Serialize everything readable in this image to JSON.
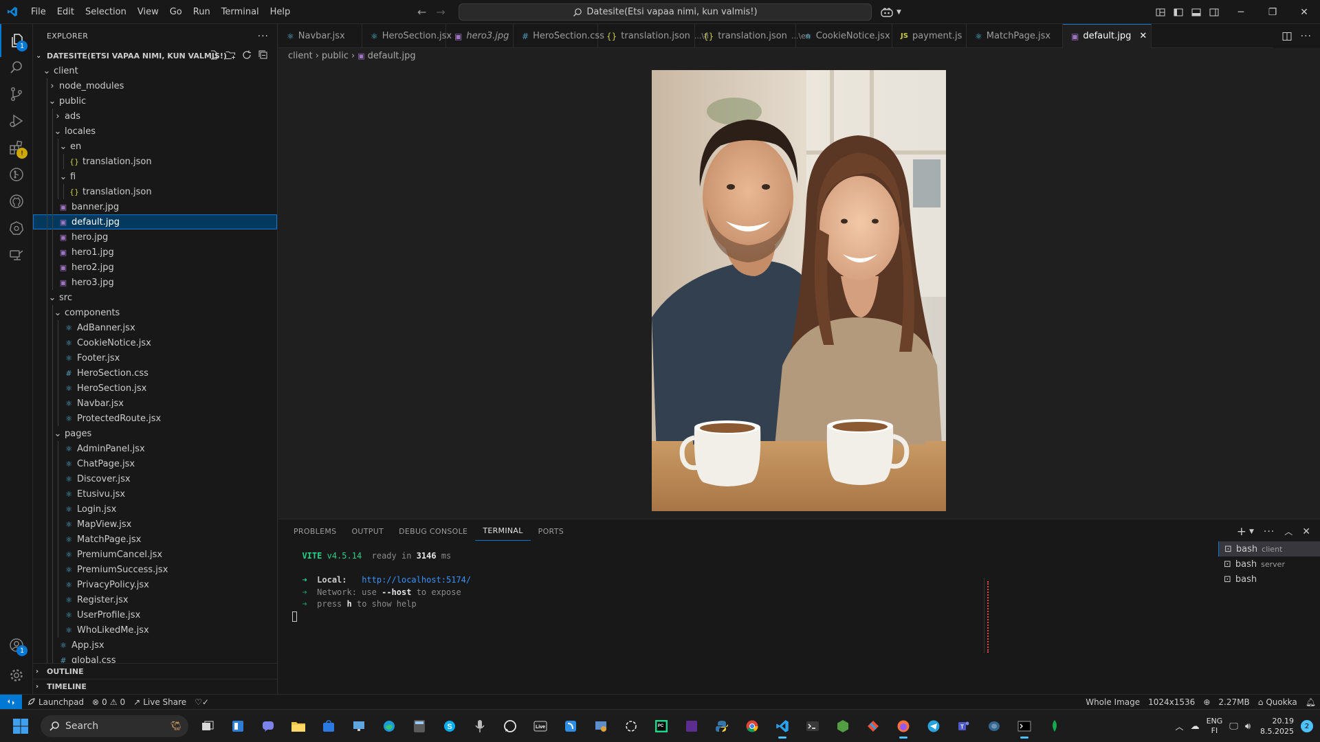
{
  "titlebar": {
    "menu": [
      "File",
      "Edit",
      "Selection",
      "View",
      "Go",
      "Run",
      "Terminal",
      "Help"
    ],
    "command_center": "Datesite(Etsi vapaa nimi, kun valmis!)"
  },
  "sidebar": {
    "title": "EXPLORER",
    "workspace": "DATESITE(ETSI VAPAA NIMI, KUN VALMIS!)",
    "tree": [
      {
        "label": "client",
        "kind": "folder-open"
      },
      {
        "label": "node_modules",
        "kind": "folder"
      },
      {
        "label": "public",
        "kind": "folder-open"
      },
      {
        "label": "ads",
        "kind": "folder"
      },
      {
        "label": "locales",
        "kind": "folder-open"
      },
      {
        "label": "en",
        "kind": "folder-open"
      },
      {
        "label": "translation.json",
        "kind": "json"
      },
      {
        "label": "fi",
        "kind": "folder-open"
      },
      {
        "label": "translation.json",
        "kind": "json"
      },
      {
        "label": "banner.jpg",
        "kind": "image"
      },
      {
        "label": "default.jpg",
        "kind": "image"
      },
      {
        "label": "hero.jpg",
        "kind": "image"
      },
      {
        "label": "hero1.jpg",
        "kind": "image"
      },
      {
        "label": "hero2.jpg",
        "kind": "image"
      },
      {
        "label": "hero3.jpg",
        "kind": "image"
      },
      {
        "label": "src",
        "kind": "folder-open"
      },
      {
        "label": "components",
        "kind": "folder-open"
      },
      {
        "label": "AdBanner.jsx",
        "kind": "react"
      },
      {
        "label": "CookieNotice.jsx",
        "kind": "react"
      },
      {
        "label": "Footer.jsx",
        "kind": "react"
      },
      {
        "label": "HeroSection.css",
        "kind": "css"
      },
      {
        "label": "HeroSection.jsx",
        "kind": "react"
      },
      {
        "label": "Navbar.jsx",
        "kind": "react"
      },
      {
        "label": "ProtectedRoute.jsx",
        "kind": "react"
      },
      {
        "label": "pages",
        "kind": "folder-open"
      },
      {
        "label": "AdminPanel.jsx",
        "kind": "react"
      },
      {
        "label": "ChatPage.jsx",
        "kind": "react"
      },
      {
        "label": "Discover.jsx",
        "kind": "react"
      },
      {
        "label": "Etusivu.jsx",
        "kind": "react"
      },
      {
        "label": "Login.jsx",
        "kind": "react"
      },
      {
        "label": "MapView.jsx",
        "kind": "react"
      },
      {
        "label": "MatchPage.jsx",
        "kind": "react"
      },
      {
        "label": "PremiumCancel.jsx",
        "kind": "react"
      },
      {
        "label": "PremiumSuccess.jsx",
        "kind": "react"
      },
      {
        "label": "PrivacyPolicy.jsx",
        "kind": "react"
      },
      {
        "label": "Register.jsx",
        "kind": "react"
      },
      {
        "label": "UserProfile.jsx",
        "kind": "react"
      },
      {
        "label": "WhoLikedMe.jsx",
        "kind": "react"
      },
      {
        "label": "App.jsx",
        "kind": "react"
      },
      {
        "label": "global.css",
        "kind": "css"
      }
    ],
    "outline": "OUTLINE",
    "timeline": "TIMELINE"
  },
  "tabs": [
    {
      "label": "Navbar.jsx",
      "kind": "react",
      "desc": ""
    },
    {
      "label": "HeroSection.jsx",
      "kind": "react",
      "desc": ""
    },
    {
      "label": "hero3.jpg",
      "kind": "image",
      "desc": ""
    },
    {
      "label": "HeroSection.css",
      "kind": "css",
      "desc": ""
    },
    {
      "label": "translation.json",
      "kind": "json",
      "desc": "...\\fi"
    },
    {
      "label": "translation.json",
      "kind": "json",
      "desc": "...\\en"
    },
    {
      "label": "CookieNotice.jsx",
      "kind": "react",
      "desc": ""
    },
    {
      "label": "payment.js",
      "kind": "js",
      "desc": ""
    },
    {
      "label": "MatchPage.jsx",
      "kind": "react",
      "desc": ""
    },
    {
      "label": "default.jpg",
      "kind": "image",
      "desc": ""
    }
  ],
  "breadcrumb": [
    "client",
    "public",
    "default.jpg"
  ],
  "panel": {
    "tabs": [
      "PROBLEMS",
      "OUTPUT",
      "DEBUG CONSOLE",
      "TERMINAL",
      "PORTS"
    ],
    "terminal": {
      "vite": "VITE",
      "version": "v4.5.14",
      "ready_prefix": "ready in",
      "ready_ms": "3146",
      "ready_unit": "ms",
      "arrow": "➜",
      "local_label": "Local:",
      "local_url": "http://localhost:5174/",
      "network_label": "Network:",
      "network_use": "use",
      "network_flag": "--host",
      "network_rest": "to expose",
      "press": "press",
      "press_key": "h",
      "press_rest": "to show help"
    },
    "terminals": [
      {
        "name": "bash",
        "desc": "client"
      },
      {
        "name": "bash",
        "desc": "server"
      },
      {
        "name": "bash",
        "desc": ""
      }
    ]
  },
  "statusbar": {
    "launchpad": "Launchpad",
    "errors": "0",
    "warnings": "0",
    "live_share": "Live Share",
    "image_mode": "Whole Image",
    "dimensions": "1024x1536",
    "size": "2.27MB",
    "quokka": "Quokka"
  },
  "taskbar": {
    "search": "Search",
    "lang1": "ENG",
    "lang2": "FI",
    "time": "20.19",
    "date": "8.5.2025",
    "notifications": "2"
  },
  "badges": {
    "explorer": "1",
    "accounts": "1"
  },
  "colors": {
    "accent": "#0078d4",
    "editor_bg": "#1f1f1f",
    "chrome_bg": "#181818",
    "react_icon": "#4fb6d8",
    "image_icon": "#a074c4",
    "json_icon": "#cbcb41",
    "css_icon": "#519aba",
    "js_icon": "#cbcb41",
    "terminal_green": "#23d18b",
    "terminal_link": "#3794ff"
  }
}
